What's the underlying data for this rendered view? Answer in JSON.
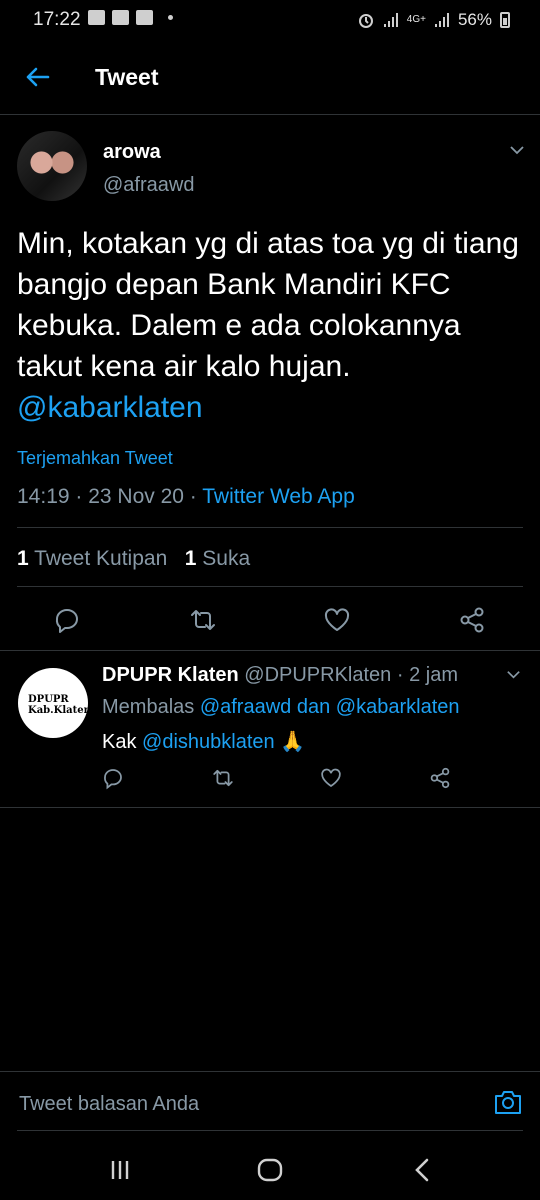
{
  "status_bar": {
    "time": "17:22",
    "battery": "56%",
    "network": "4G+"
  },
  "header": {
    "title": "Tweet"
  },
  "tweet": {
    "author_name": "arowa",
    "author_handle": "@afraawd",
    "text_plain": "Min, kotakan yg di atas toa yg di tiang bangjo depan Bank Mandiri KFC kebuka. Dalem e ada colokannya takut kena air kalo hujan.",
    "text_mention": "@kabarklaten",
    "translate_label": "Terjemahkan Tweet",
    "time": "14:19",
    "date": "23 Nov 20",
    "source": "Twitter Web App",
    "quote_count": "1",
    "quote_label": "Tweet Kutipan",
    "like_count": "1",
    "like_label": "Suka"
  },
  "reply": {
    "author_name": "DPUPR Klaten",
    "author_handle": "@DPUPRKlaten",
    "time_ago": "2 jam",
    "avatar_text_line1": "DPUPR",
    "avatar_text_line2": "Kab.Klaten",
    "replying_label": "Membalas",
    "replying_to_1": "@afraawd",
    "replying_conj": "dan",
    "replying_to_2": "@kabarklaten",
    "text_prefix": "Kak",
    "text_mention": "@dishubklaten",
    "text_emoji": "🙏"
  },
  "composer": {
    "placeholder": "Tweet balasan Anda"
  },
  "colors": {
    "accent": "#1da1f2",
    "muted": "#8899a6",
    "background": "#000000",
    "divider": "#2f3336"
  },
  "icons": [
    "back-arrow-icon",
    "chevron-down-icon",
    "reply-icon",
    "retweet-icon",
    "like-icon",
    "share-icon",
    "camera-icon",
    "recent-apps-icon",
    "home-icon",
    "back-icon"
  ]
}
